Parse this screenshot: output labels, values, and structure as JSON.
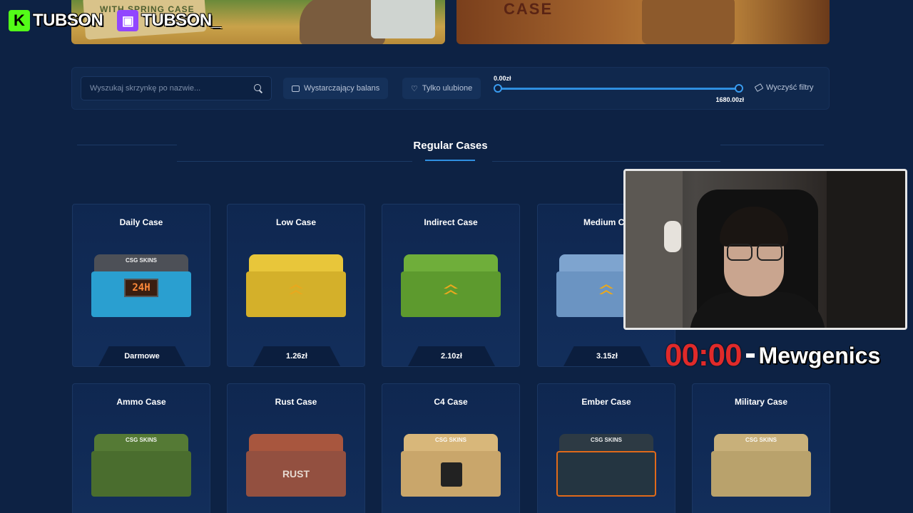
{
  "overlay": {
    "kick_name": "TUBSON",
    "kick_icon": "K",
    "twitch_name": "TUBSON_",
    "twitch_icon": "▣",
    "timer": "00:00",
    "game": "Mewgenics"
  },
  "banners": {
    "left_text": "WITH SPRING CASE",
    "right_text": "CASE"
  },
  "filters": {
    "search_placeholder": "Wyszukaj skrzynkę po nazwie...",
    "balance_label": "Wystarczający balans",
    "favorites_label": "Tylko ulubione",
    "price_min": "0.00zł",
    "price_max": "1680.00zł",
    "clear_label": "Wyczyść filtry"
  },
  "section": {
    "title": "Regular Cases"
  },
  "cases_row1": [
    {
      "name": "Daily Case",
      "price": "Darmowe"
    },
    {
      "name": "Low Case",
      "price": "1.26zł"
    },
    {
      "name": "Indirect Case",
      "price": "2.10zł"
    },
    {
      "name": "Medium Ca",
      "price": "3.15zł"
    }
  ],
  "cases_row2": [
    {
      "name": "Ammo Case"
    },
    {
      "name": "Rust Case"
    },
    {
      "name": "C4 Case"
    },
    {
      "name": "Ember Case"
    },
    {
      "name": "Military Case"
    }
  ],
  "box_labels": {
    "brand": "CSG SKINS",
    "daily_display": "24H",
    "rust": "RUST"
  },
  "colors": {
    "background": "#0d2244",
    "accent": "#2f8fe0",
    "timer_red": "#e02a2a",
    "kick_green": "#53fc18",
    "twitch_purple": "#9146ff"
  }
}
